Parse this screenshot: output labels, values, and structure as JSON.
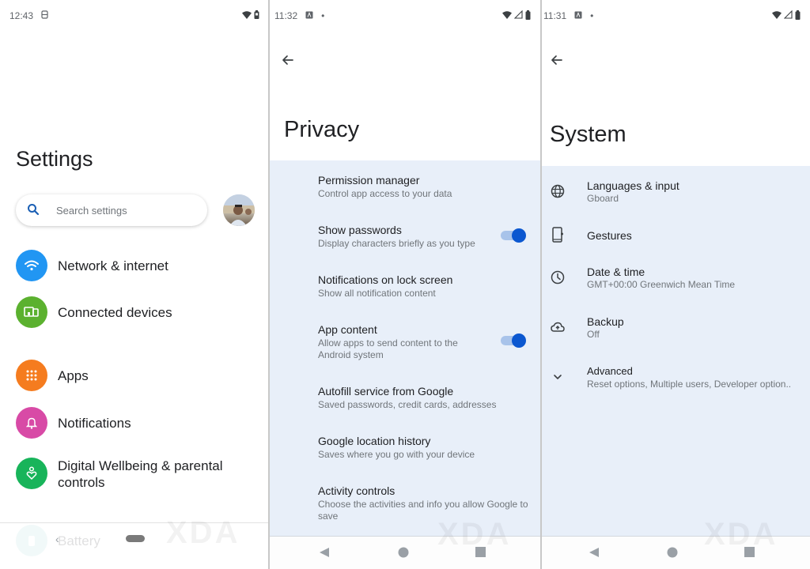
{
  "screens": {
    "settings": {
      "status": {
        "time": "12:43",
        "notif_icon": "sim-icon",
        "right_icons": [
          "wifi-icon",
          "battery-icon"
        ]
      },
      "title": "Settings",
      "search_placeholder": "Search settings",
      "avatar": "user-avatar",
      "items": [
        {
          "label": "Network & internet",
          "icon": "wifi-icon",
          "color": "#1a73e8"
        },
        {
          "label": "Connected devices",
          "icon": "devices-icon",
          "color": "#5bb12f"
        },
        {
          "label": "Apps",
          "icon": "apps-grid-icon",
          "color": "#f57c1f"
        },
        {
          "label": "Notifications",
          "icon": "bell-icon",
          "color": "#d84aa6"
        },
        {
          "label": "Digital Wellbeing & parental controls",
          "icon": "wellbeing-icon",
          "color": "#18b45a"
        },
        {
          "label": "Battery",
          "icon": "battery-icon",
          "color": "#18a8a0"
        }
      ],
      "watermark": "XDA"
    },
    "privacy": {
      "status": {
        "time": "11:32",
        "notif_icon": "a-icon",
        "dot": "•",
        "right_icons": [
          "wifi-icon",
          "signal-icon",
          "battery-icon"
        ]
      },
      "title": "Privacy",
      "items": [
        {
          "title": "Permission manager",
          "subtitle": "Control app access to your data",
          "toggle": null
        },
        {
          "title": "Show passwords",
          "subtitle": "Display characters briefly as you type",
          "toggle": true
        },
        {
          "title": "Notifications on lock screen",
          "subtitle": "Show all notification content",
          "toggle": null
        },
        {
          "title": "App content",
          "subtitle": "Allow apps to send content to the Android system",
          "toggle": true
        },
        {
          "title": "Autofill service from Google",
          "subtitle": "Saved passwords, credit cards, addresses",
          "toggle": null
        },
        {
          "title": "Google location history",
          "subtitle": "Saves where you go with your device",
          "toggle": null
        },
        {
          "title": "Activity controls",
          "subtitle": "Choose the activities and info you allow Google to save",
          "toggle": null
        }
      ],
      "watermark": "XDA"
    },
    "system": {
      "status": {
        "time": "11:31",
        "notif_icon": "a-icon",
        "dot": "•",
        "right_icons": [
          "wifi-icon",
          "signal-icon",
          "battery-icon"
        ]
      },
      "title": "System",
      "items": [
        {
          "title": "Languages & input",
          "subtitle": "Gboard",
          "icon": "globe-icon"
        },
        {
          "title": "Gestures",
          "subtitle": "",
          "icon": "gestures-phone-icon"
        },
        {
          "title": "Date & time",
          "subtitle": "GMT+00:00 Greenwich Mean Time",
          "icon": "clock-icon"
        },
        {
          "title": "Backup",
          "subtitle": "Off",
          "icon": "cloud-upload-icon"
        },
        {
          "title": "Advanced",
          "subtitle": "Reset options, Multiple users, Developer option..",
          "icon": "chevron-down-icon"
        }
      ],
      "watermark": "XDA"
    }
  },
  "colors": {
    "accent": "#0b57d0",
    "list_bg": "#e8eff9",
    "toggle_track": "#a8c3ea"
  }
}
